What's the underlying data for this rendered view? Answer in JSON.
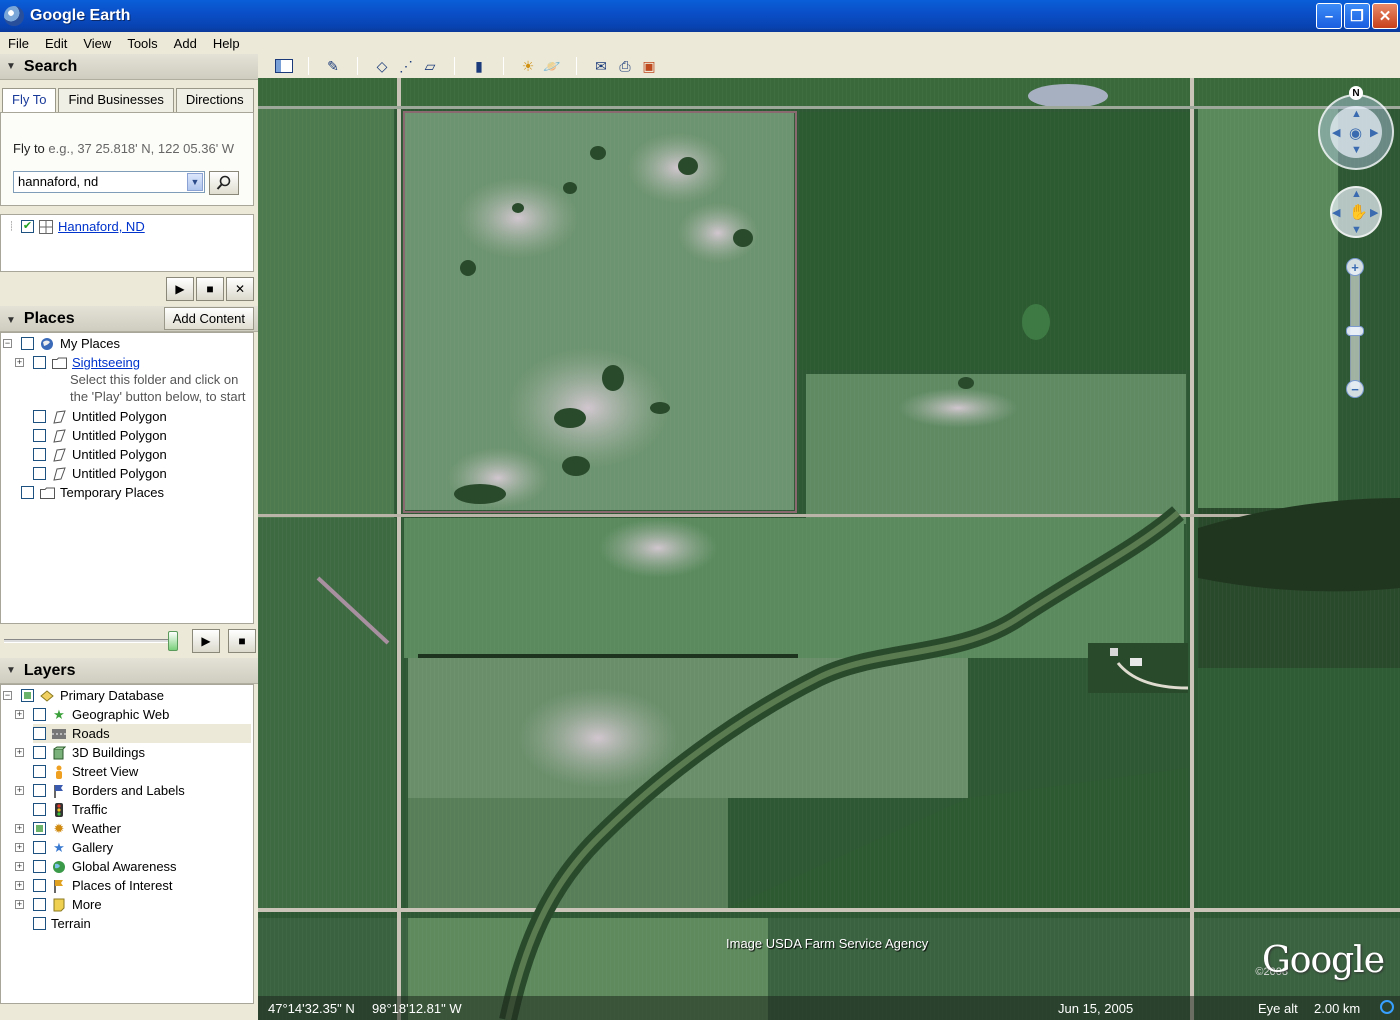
{
  "window": {
    "title": "Google Earth"
  },
  "menu": [
    "File",
    "Edit",
    "View",
    "Tools",
    "Add",
    "Help"
  ],
  "search": {
    "header": "Search",
    "tabs": [
      "Fly To",
      "Find Businesses",
      "Directions"
    ],
    "fly_label": "Fly to",
    "fly_example": "e.g., 37 25.818' N, 122 05.36' W",
    "query": "hannaford, nd",
    "result": "Hannaford, ND"
  },
  "places": {
    "header": "Places",
    "add_content": "Add Content",
    "my_places": "My Places",
    "sightseeing": "Sightseeing",
    "sightseeing_desc_1": "Select this folder and click on",
    "sightseeing_desc_2": "the 'Play' button below, to start",
    "polygons": [
      "Untitled Polygon",
      "Untitled Polygon",
      "Untitled Polygon",
      "Untitled Polygon"
    ],
    "temporary": "Temporary Places"
  },
  "layers": {
    "header": "Layers",
    "root": "Primary Database",
    "items": [
      "Geographic Web",
      "Roads",
      "3D Buildings",
      "Street View",
      "Borders and Labels",
      "Traffic",
      "Weather",
      "Gallery",
      "Global Awareness",
      "Places of Interest",
      "More"
    ],
    "terrain": "Terrain"
  },
  "map": {
    "attribution": "Image USDA Farm Service Agency",
    "copyright": "©2008",
    "logo": "Google",
    "latitude": "47°14'32.35\" N",
    "longitude": "98°18'12.81\" W",
    "date": "Jun 15, 2005",
    "eye_alt_label": "Eye alt",
    "eye_alt_value": "2.00 km",
    "north": "N"
  }
}
